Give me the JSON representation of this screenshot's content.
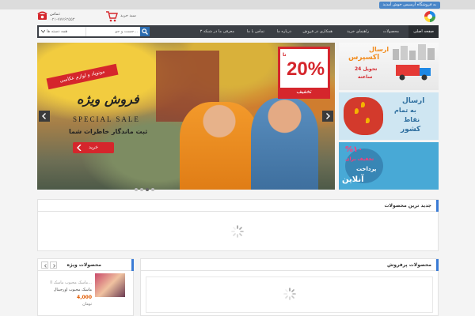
{
  "topbar": {
    "welcome_text": "به فروشگاه آرسیس خوش آمدید"
  },
  "header": {
    "cart_label": "سبد خرید",
    "contact_label": "تماس:",
    "phone_number": "۰۲۱-۷۷۷۶۲۵۵۳"
  },
  "nav": {
    "items": [
      {
        "label": "صفحه اصلی"
      },
      {
        "label": "محصولات"
      },
      {
        "label": "راهنمای خرید"
      },
      {
        "label": "همکاری در فروش"
      },
      {
        "label": "درباره ما"
      },
      {
        "label": "تماس با ما"
      },
      {
        "label": "معرفی ما در شبکه ۳"
      }
    ]
  },
  "search": {
    "categories_label": "همه دسته ها",
    "placeholder": "جست و جو..."
  },
  "slider": {
    "sale_up_to": "تا",
    "sale_percent": "20%",
    "sale_word": "تخفیف",
    "banner_text": "مونوپاد و لوازم عکاسی",
    "title": "فروش ویژه",
    "subtitle": "SPECIAL SALE",
    "tagline": "ثبت ماندگار خاطرات شما",
    "buy_label": "خرید",
    "slide_count": 4,
    "active_slide": 1
  },
  "side_banners": {
    "express": {
      "line1": "ارسال",
      "line2": "اکسپرس",
      "line3": "تحویل 24",
      "line4": "ساعته"
    },
    "shipping": {
      "line1": "ارسال",
      "line2": "به تمام",
      "line3": "نقاط",
      "line4": "کشور"
    },
    "discount": {
      "line1": "%۱۰",
      "line2": "تخفیف برای",
      "line3": "پرداخت",
      "line4": "آنلاین"
    }
  },
  "sections": {
    "newest_title": "جدید ترین محصولات",
    "special_title": "محصولات ویژه",
    "bestseller_title": "محصولات پرفروش"
  },
  "special_product": {
    "name_line1": "ماسک محبوب ماسک اا...",
    "name_line2": "ماسک محبوب اورجینال",
    "price": "4,000",
    "currency": "تومان"
  },
  "colors": {
    "accent": "#3a7bd5",
    "nav_bg": "#3b3f45",
    "sale_red": "#d5262c",
    "price_orange": "#e05a00"
  }
}
